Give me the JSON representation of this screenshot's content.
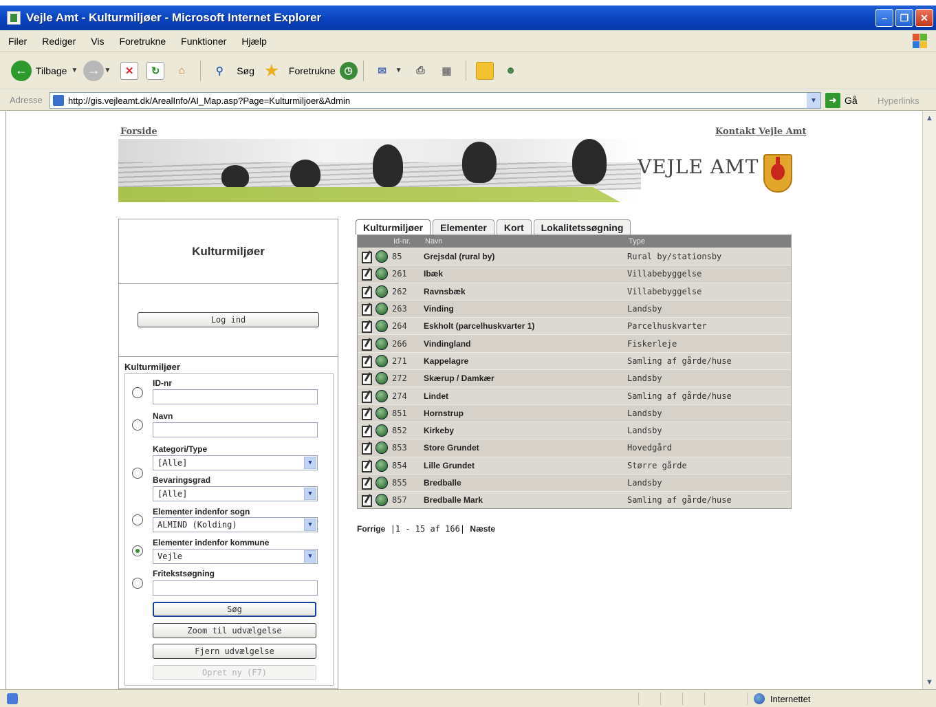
{
  "window": {
    "title": "Vejle Amt - Kulturmiljøer - Microsoft Internet Explorer",
    "buttons": {
      "minimize": "–",
      "restore": "❐",
      "close": "✕"
    }
  },
  "menu": [
    "Filer",
    "Rediger",
    "Vis",
    "Foretrukne",
    "Funktioner",
    "Hjælp"
  ],
  "toolbar": {
    "back_label": "Tilbage",
    "search_label": "Søg",
    "favorites_label": "Foretrukne"
  },
  "address": {
    "label": "Adresse",
    "url": "http://gis.vejleamt.dk/ArealInfo/AI_Map.asp?Page=Kulturmiljoer&Admin",
    "go_label": "Gå",
    "links_label": "Hyperlinks"
  },
  "page": {
    "home_link": "Forside",
    "contact_link": "Kontakt Vejle Amt",
    "brand": "VEJLE AMT"
  },
  "left_panel": {
    "title": "Kulturmiljøer",
    "login_button": "Log ind",
    "section_title": "Kulturmiljøer",
    "fields": {
      "id_label": "ID-nr",
      "name_label": "Navn",
      "category_label": "Kategori/Type",
      "category_value": "[Alle]",
      "preservation_label": "Bevaringsgrad",
      "preservation_value": "[Alle]",
      "parish_label": "Elementer indenfor sogn",
      "parish_value": "ALMIND (Kolding)",
      "municipality_label": "Elementer indenfor kommune",
      "municipality_value": "Vejle",
      "freetext_label": "Fritekstsøgning"
    },
    "buttons": {
      "search": "Søg",
      "zoom": "Zoom til udvælgelse",
      "remove": "Fjern udvælgelse",
      "create": "Opret ny (F7)"
    }
  },
  "tabs": [
    "Kulturmiljøer",
    "Elementer",
    "Kort",
    "Lokalitetssøgning"
  ],
  "table": {
    "headers": {
      "id": "Id-nr.",
      "name": "Navn",
      "type": "Type"
    },
    "rows": [
      {
        "id": "85",
        "name": "Grejsdal (rural by)",
        "type": "Rural by/stationsby"
      },
      {
        "id": "261",
        "name": "Ibæk",
        "type": "Villabebyggelse"
      },
      {
        "id": "262",
        "name": "Ravnsbæk",
        "type": "Villabebyggelse"
      },
      {
        "id": "263",
        "name": "Vinding",
        "type": "Landsby"
      },
      {
        "id": "264",
        "name": "Eskholt (parcelhuskvarter 1)",
        "type": "Parcelhuskvarter"
      },
      {
        "id": "266",
        "name": "Vindingland",
        "type": "Fiskerleje"
      },
      {
        "id": "271",
        "name": "Kappelagre",
        "type": "Samling af gårde/huse"
      },
      {
        "id": "272",
        "name": "Skærup / Damkær",
        "type": "Landsby"
      },
      {
        "id": "274",
        "name": "Lindet",
        "type": "Samling af gårde/huse"
      },
      {
        "id": "851",
        "name": "Hornstrup",
        "type": "Landsby"
      },
      {
        "id": "852",
        "name": "Kirkeby",
        "type": "Landsby"
      },
      {
        "id": "853",
        "name": "Store Grundet",
        "type": "Hovedgård"
      },
      {
        "id": "854",
        "name": "Lille Grundet",
        "type": "Større gårde"
      },
      {
        "id": "855",
        "name": "Bredballe",
        "type": "Landsby"
      },
      {
        "id": "857",
        "name": "Bredballe Mark",
        "type": "Samling af gårde/huse"
      }
    ]
  },
  "pager": {
    "prev": "Forrige",
    "info": "|1 - 15 af 166|",
    "next": "Næste"
  },
  "status": {
    "zone": "Internettet"
  }
}
